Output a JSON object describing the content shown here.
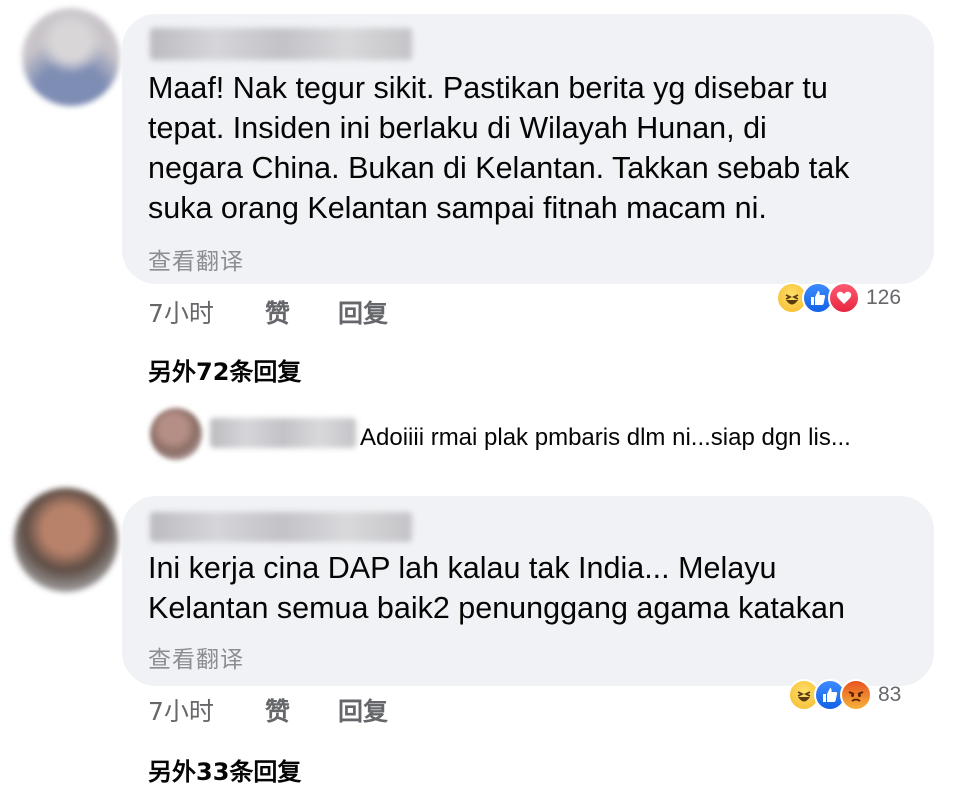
{
  "comments": [
    {
      "text": "Maaf! Nak tegur sikit. Pastikan berita yg disebar tu\ntepat. Insiden ini berlaku di Wilayah Hunan, di\nnegara China. Bukan di Kelantan. Takkan sebab tak\nsuka orang Kelantan sampai fitnah macam ni.",
      "translate_label": "查看翻译",
      "time": "7小时",
      "like_label": "赞",
      "reply_label": "回复",
      "reactions": [
        "haha",
        "like",
        "love"
      ],
      "reaction_count": "126",
      "more_replies": "另外72条回复",
      "reply_preview": "Adoiiii rmai plak pmbaris dlm ni...siap dgn lis..."
    },
    {
      "text": "Ini kerja cina DAP lah kalau tak India... Melayu\nKelantan semua baik2 penunggang agama katakan",
      "translate_label": "查看翻译",
      "time": "7小时",
      "like_label": "赞",
      "reply_label": "回复",
      "reactions": [
        "haha",
        "like",
        "angry"
      ],
      "reaction_count": "83",
      "more_replies": "另外33条回复"
    }
  ],
  "colors": {
    "bubble": "#f0f2f5",
    "secondary_text": "#65676b",
    "like_blue": "#1877f2",
    "love_red": "#f33e58"
  }
}
